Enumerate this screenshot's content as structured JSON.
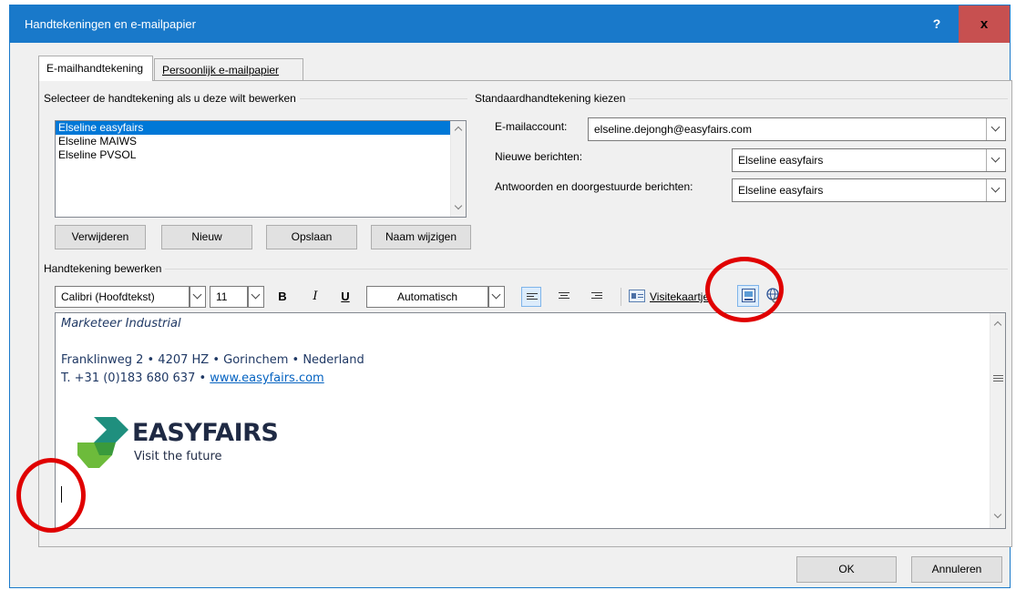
{
  "window": {
    "title": "Handtekeningen en e-mailpapier",
    "help_label": "?",
    "close_label": "x"
  },
  "tabs": [
    {
      "label": "E-mailhandtekening",
      "active": true
    },
    {
      "label": "Persoonlijk e-mailpapier",
      "active": false
    }
  ],
  "select_group": {
    "label": "Selecteer de handtekening als u deze wilt bewerken",
    "signatures": [
      "Elseline easyfairs",
      "Elseline MAIWS",
      "Elseline PVSOL"
    ],
    "selected_index": 0,
    "buttons": {
      "delete": "Verwijderen",
      "new": "Nieuw",
      "save": "Opslaan",
      "rename": "Naam wijzigen"
    }
  },
  "default_group": {
    "label": "Standaardhandtekening kiezen",
    "email_account_label": "E-mailaccount:",
    "email_account_value": "elseline.dejongh@easyfairs.com",
    "new_messages_label": "Nieuwe berichten:",
    "new_messages_value": "Elseline easyfairs",
    "replies_label": "Antwoorden en doorgestuurde berichten:",
    "replies_value": "Elseline easyfairs"
  },
  "edit_group": {
    "label": "Handtekening bewerken",
    "font_value": "Calibri (Hoofdtekst)",
    "size_value": "11",
    "bold_label": "B",
    "italic_label": "I",
    "underline_label": "U",
    "color_value": "Automatisch",
    "business_card_label": "Visitekaartje"
  },
  "signature": {
    "line1": "Marketeer Industrial",
    "line2": "Franklinweg 2 •  4207 HZ •  Gorinchem •  Nederland",
    "line3_prefix": "T. +31 (0)183 680 637 •  ",
    "website": "www.easyfairs.com",
    "logo_text": "EASYFAIRS",
    "logo_tagline": "Visit the future"
  },
  "footer": {
    "ok_label": "OK",
    "cancel_label": "Annuleren"
  },
  "colors": {
    "title_bar": "#1979ca",
    "close_button": "#c75050",
    "selection": "#0078d7",
    "annotation": "#e00000",
    "logo_green": "#3a9a3c"
  }
}
